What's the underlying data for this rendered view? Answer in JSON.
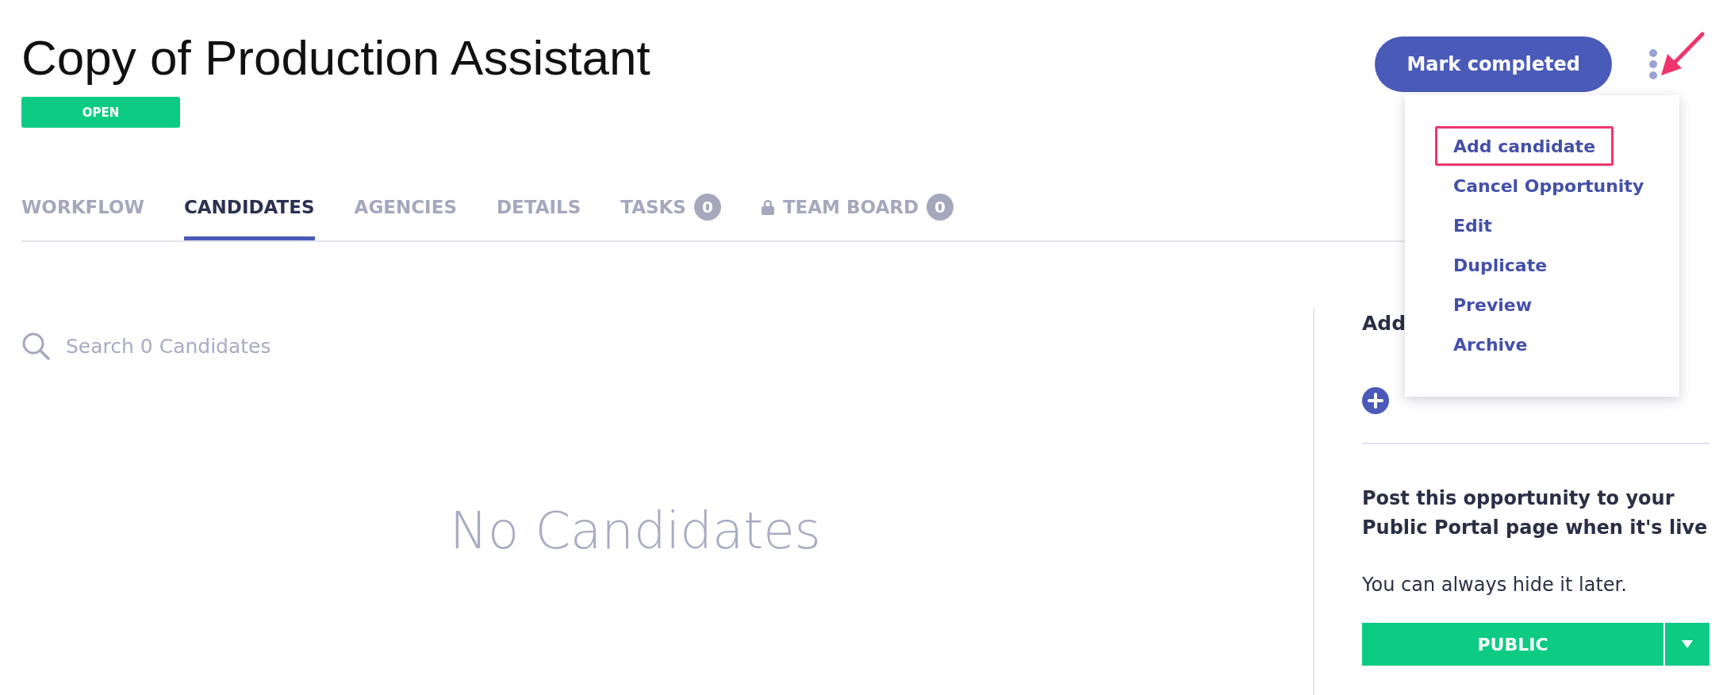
{
  "title": "Copy of Production Assistant",
  "status": {
    "label": "OPEN"
  },
  "actions": {
    "primary": "Mark completed"
  },
  "tabs": [
    {
      "label": "WORKFLOW",
      "selected": false
    },
    {
      "label": "CANDIDATES",
      "selected": true
    },
    {
      "label": "AGENCIES",
      "selected": false
    },
    {
      "label": "DETAILS",
      "selected": false
    },
    {
      "label": "TASKS",
      "selected": false,
      "count": "0"
    },
    {
      "label": "TEAM BOARD",
      "selected": false,
      "count": "0",
      "locked": true
    }
  ],
  "search": {
    "placeholder": "Search 0 Candidates"
  },
  "empty_state": "No Candidates",
  "side_panel": {
    "heading": "Add",
    "post_text": "Post this opportunity to your Public Portal page when it's live",
    "hint": "You can always hide it later.",
    "visibility": "PUBLIC"
  },
  "menu": {
    "items": [
      {
        "label": "Add candidate",
        "highlighted": true
      },
      {
        "label": "Cancel Opportunity",
        "highlighted": false
      },
      {
        "label": "Edit",
        "highlighted": false
      },
      {
        "label": "Duplicate",
        "highlighted": false
      },
      {
        "label": "Preview",
        "highlighted": false
      },
      {
        "label": "Archive",
        "highlighted": false
      }
    ]
  }
}
